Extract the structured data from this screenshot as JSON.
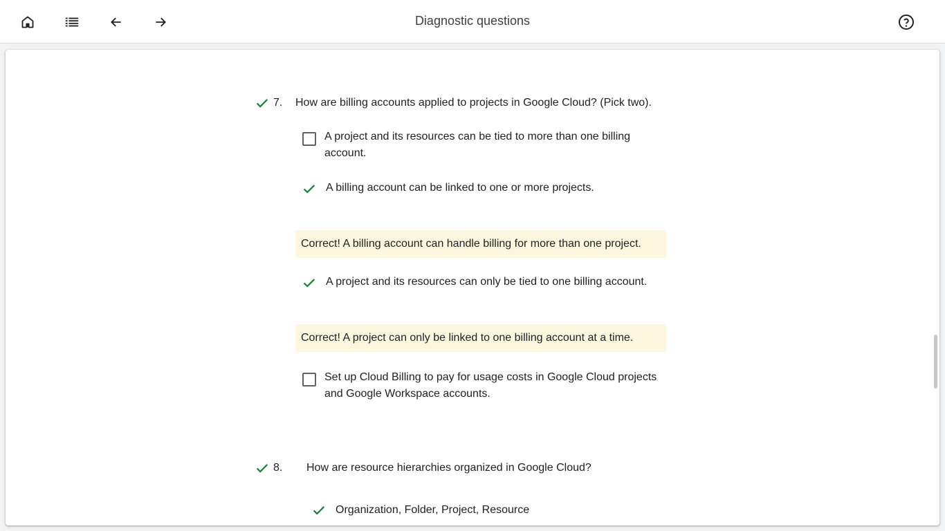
{
  "header": {
    "title": "Diagnostic questions",
    "icons": [
      "home-icon",
      "list-icon",
      "arrow-back-icon",
      "arrow-forward-icon",
      "help-icon"
    ]
  },
  "colors": {
    "correct_green": "#188038",
    "feedback_bg": "#fef7e0"
  },
  "questions": [
    {
      "number": "7.",
      "text": "How are billing accounts applied to projects in Google Cloud? (Pick two).",
      "options": [
        {
          "text_line1": "A project and its resources can be tied to more than one billing",
          "text_line2": "account.",
          "selected": false
        },
        {
          "text": "A billing account can be linked to one or more projects.",
          "selected": true,
          "feedback": "Correct! A billing account can handle billing for more than one project."
        },
        {
          "text": "A project and its resources can only be tied to one billing account.",
          "selected": true,
          "feedback": "Correct! A project can only be linked to one billing account at a time."
        },
        {
          "text_line1": "Set up Cloud Billing to pay for usage costs in Google Cloud projects",
          "text_line2": "and Google Workspace accounts.",
          "selected": false
        }
      ]
    },
    {
      "number": "8.",
      "text": "How are resource hierarchies organized in Google Cloud?",
      "options": [
        {
          "text": "Organization, Folder, Project, Resource",
          "selected": true
        }
      ]
    }
  ]
}
